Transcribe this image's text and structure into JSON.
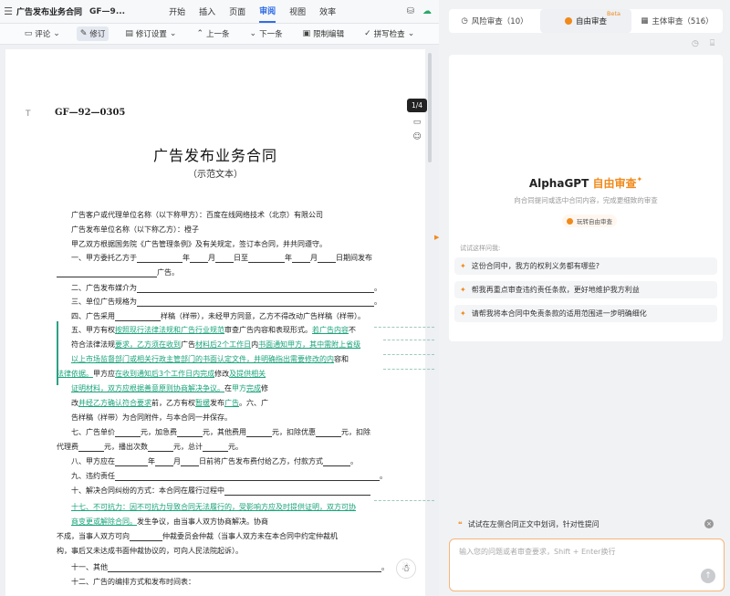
{
  "titlebar": {
    "doc_title": "广告发布业务合同",
    "doc_code": "GF—9...",
    "menus": [
      "开始",
      "插入",
      "页面",
      "审阅",
      "视图",
      "效率"
    ]
  },
  "toolbar": {
    "comment": "评论",
    "revise": "修订",
    "revise_settings": "修订设置",
    "prev": "上一条",
    "next": "下一条",
    "restrict_edit": "限制编辑",
    "spell_check": "拼写检查"
  },
  "side": {
    "page_indicator": "1/4"
  },
  "document": {
    "code": "GF—92—0305",
    "title": "广告发布业务合同",
    "subtitle": "（示范文本）",
    "l1": "广告客户或代理单位名称（以下称甲方）：百度在线网络技术（北京）有限公司",
    "l2": "广告发布单位名称（以下称乙方）：橙子",
    "l3": "甲乙双方根据国务院《广告管理条例》及有关规定，签订本合同，并共同遵守。",
    "l4a": "一、甲方委托乙方于",
    "l4b": "年",
    "l4c": "月",
    "l4d": "日至",
    "l4e": "年",
    "l4f": "月",
    "l4g": "日期间发布",
    "l5": "广告。",
    "l6": "二、广告发布媒介为",
    "l7": "三、单位广告规格为",
    "l8a": "四、广告采用",
    "l8b": "样稿（样带），未经甲方同意，乙方不得改动广告样稿（样带）。",
    "l9a": "五、甲方有权",
    "l9b": "按照现行法律法规和广告行业规范",
    "l9c": "审查广告内容和表现形式。",
    "l9d": "若广告内容",
    "l9e": "不",
    "l10a": "符合法律法规",
    "l10b": "要求，乙方须在收到",
    "l10c": "广告",
    "l10d": "材料后2个工作日",
    "l10e": "内",
    "l10f": "书面通知甲方，其中需附上省级",
    "l11a": "以上市场监督部门或相关行政主管部门的书面认定文件，并明确指出需要修改的内",
    "l11b": "容和",
    "l12a": "法律依据。",
    "l12b": "甲方应",
    "l12c": "在收到通知后3个工作日内完成",
    "l12d": "修改",
    "l12e": "及提供相关",
    "l13a": "证明材料，双方应根据善意原则协商解决争议。",
    "l13b": "在",
    "l13c": "甲方",
    "l13d": "完成",
    "l13e": "修",
    "l14a": "改",
    "l14b": "并经乙方确认符合要求",
    "l14c": "前，乙方有权",
    "l14d": "暂缓",
    "l14e": "发布",
    "l14f": "广告",
    "l14g": "。六、广",
    "l15": "告样稿（样带）为合同附件，与本合同一并保存。",
    "l16a": "七、广告单价",
    "l16b": "元，加急费",
    "l16c": "元，其他费用",
    "l16d": "元，扣除优惠",
    "l16e": "元，扣除",
    "l17a": "代理费",
    "l17b": "元，播出次数",
    "l17c": "元，总计",
    "l17d": "元。",
    "l18a": "八、甲方应在",
    "l18b": "年",
    "l18c": "月",
    "l18d": "日前将广告发布费付给乙方，付款方式",
    "l18e": "。",
    "l19": "九、违约责任",
    "l20": "十、解决合同纠纷的方式：本合同在履行过程中",
    "l21": "十七、不可抗力：因不可抗力导致合同无法履行的，受影响方应及时提供证明，双方可协",
    "l22a": "商变更或解除合同。",
    "l22b": "发生争议，由当事人双方协商解决。协商",
    "l23a": "不成，当事人双方可向",
    "l23b": "仲裁委员会仲裁（当事人双方未在本合同中约定仲裁机",
    "l24": "构，事后又未达成书面仲裁协议的，可向人民法院起诉）。",
    "l25": "十一、其他",
    "l26": "十二、广告的编排方式和发布时间表："
  },
  "right": {
    "tabs": [
      {
        "label": "风险审查（10）"
      },
      {
        "label": "自由审查",
        "badge": "Beta"
      },
      {
        "label": "主体审查（516）"
      }
    ],
    "brand_prefix": "AlphaGPT",
    "brand_accent": "自由审查",
    "brand_sub": "向合同提问或选中合同内容，完成更细致的审查",
    "try_label": "玩转自由审查",
    "suggest_title": "试试这样问我:",
    "suggestions": [
      "这份合同中，我方的权利义务都有哪些?",
      "帮我再重点审查违约责任条款，更好地维护我方利益",
      "请帮我将本合同中免责条款的适用范围进一步明确细化"
    ],
    "hint_text": "试试在左侧合同正文中划词，针对性提问",
    "input_placeholder": "输入您的问题或者审查要求，Shift + Enter换行"
  },
  "colors": {
    "accent": "#f08a1c",
    "brand_blue": "#2f6ee8",
    "track_green": "#1aa37a"
  }
}
